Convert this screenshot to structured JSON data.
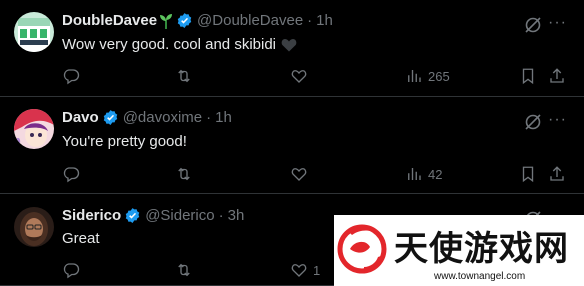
{
  "tweets": [
    {
      "name": "DoubleDavee",
      "handle": "@DoubleDavee",
      "separator": "·",
      "time": "1h",
      "text": "Wow very good. cool and skibidi",
      "views": "265",
      "likes": ""
    },
    {
      "name": "Davo",
      "handle": "@davoxime",
      "separator": "·",
      "time": "1h",
      "text": "You're pretty good!",
      "views": "42",
      "likes": ""
    },
    {
      "name": "Siderico",
      "handle": "@Siderico",
      "separator": "·",
      "time": "3h",
      "text": "Great",
      "views": "",
      "likes": "1"
    }
  ],
  "watermark": {
    "title": "天使游戏网",
    "url": "www.townangel.com"
  },
  "colors": {
    "background": "#000000",
    "verified": "#1d9bf0",
    "muted": "#71767b",
    "text": "#e7e9ea",
    "divider": "#2f3336"
  }
}
